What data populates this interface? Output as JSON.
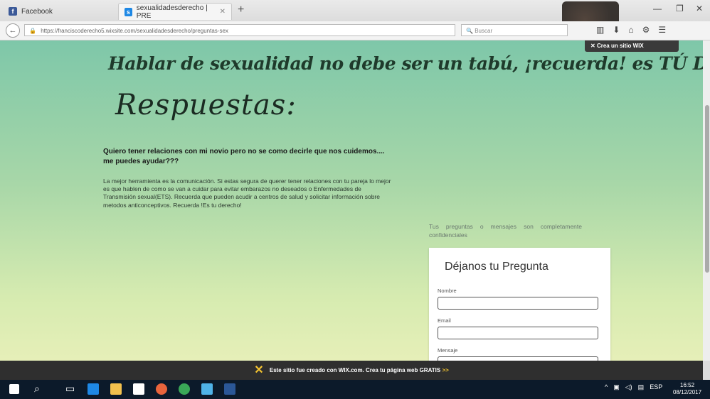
{
  "browser": {
    "tabs": [
      {
        "label": "Facebook"
      },
      {
        "label": "sexualidadesderecho | PRE"
      }
    ],
    "url": "https://franciscoderecho5.wixsite.com/sexualidadesderecho/preguntas-sex",
    "search_placeholder": "Buscar"
  },
  "page": {
    "wix_create_label": "Crea un sitio WIX",
    "headline": "Hablar de sexualidad no debe ser un tabú, ¡recuerda! es TÚ DERECHO",
    "section_title": "Respuestas:",
    "question": "Quiero tener relaciones con mi novio pero no se como decirle que nos cuidemos.... me puedes ayudar???",
    "answer": "La mejor herramienta es la comunicación. Si estas segura de querer tener relaciones con tu pareja lo mejor es que hablen de como se van a cuidar para evitar embarazos no deseados o Enfermedades de Transmisión sexual(ETS). Recuerda que pueden acudir a centros de salud y solicitar información sobre metodos anticonceptivos. Recuerda !Es tu derecho!",
    "confidential_note": "Tus preguntas o mensajes son completamente confidenciales",
    "form": {
      "title": "Déjanos tu Pregunta",
      "name_label": "Nombre",
      "email_label": "Email",
      "message_label": "Mensaje"
    }
  },
  "wix_banner": {
    "text": "Este sitio fue creado con WIX.com. Crea tu página web GRATIS",
    "link": ">>"
  },
  "taskbar": {
    "time": "16:52",
    "date": "08/12/2017",
    "lang": "ESP"
  }
}
